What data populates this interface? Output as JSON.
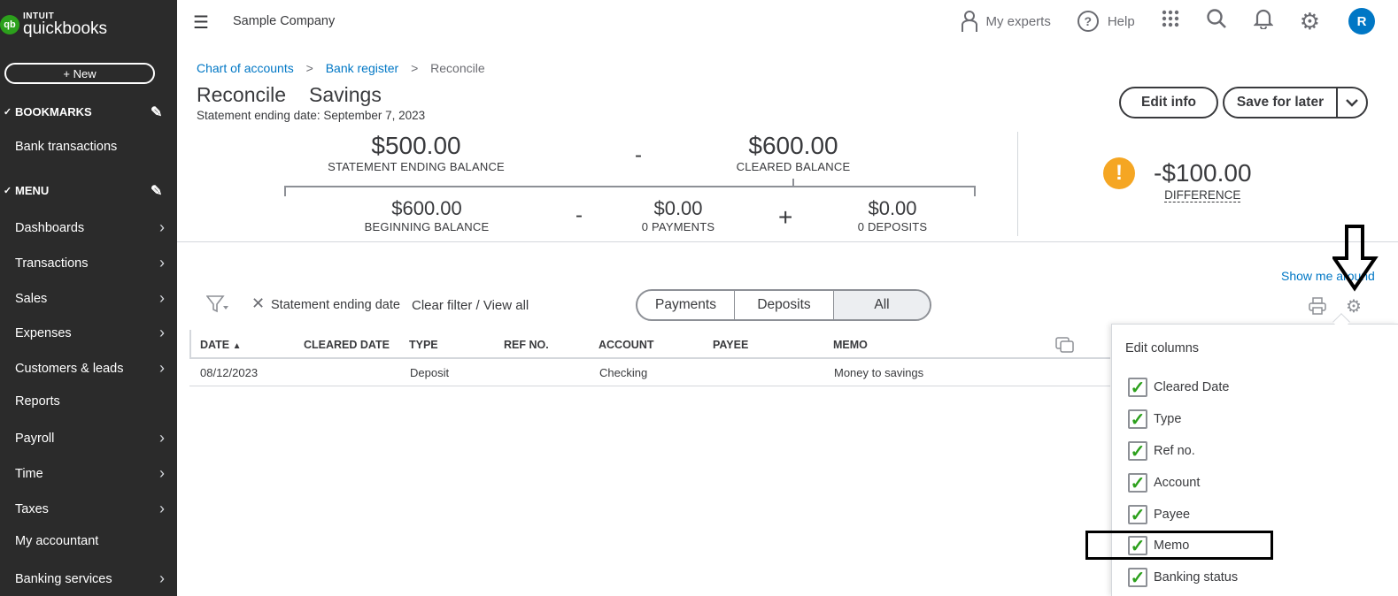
{
  "brand": {
    "intuit": "INTUIT",
    "product": "quickbooks",
    "mark": "qb"
  },
  "sidebar": {
    "new_label": "+ New",
    "bookmarks_label": "BOOKMARKS",
    "bookmark_items": [
      "Bank transactions"
    ],
    "menu_label": "MENU",
    "menu_items": [
      {
        "label": "Dashboards",
        "arrow": true
      },
      {
        "label": "Transactions",
        "arrow": true
      },
      {
        "label": "Sales",
        "arrow": true
      },
      {
        "label": "Expenses",
        "arrow": true
      },
      {
        "label": "Customers & leads",
        "arrow": true
      },
      {
        "label": "Reports",
        "arrow": false
      },
      {
        "label": "Payroll",
        "arrow": true
      },
      {
        "label": "Time",
        "arrow": true
      },
      {
        "label": "Taxes",
        "arrow": true
      },
      {
        "label": "My accountant",
        "arrow": false
      },
      {
        "label": "Banking services",
        "arrow": true
      }
    ]
  },
  "topbar": {
    "company": "Sample Company",
    "my_experts": "My experts",
    "help": "Help",
    "avatar_initial": "R"
  },
  "breadcrumb": {
    "items": [
      "Chart of accounts",
      "Bank register"
    ],
    "current": "Reconcile"
  },
  "page": {
    "title": "Reconcile",
    "account": "Savings",
    "subtitle": "Statement ending date: September 7, 2023",
    "edit_info": "Edit info",
    "save_for_later": "Save for later"
  },
  "summary": {
    "statement_ending_balance": {
      "value": "$500.00",
      "label": "STATEMENT ENDING BALANCE"
    },
    "cleared_balance": {
      "value": "$600.00",
      "label": "CLEARED BALANCE"
    },
    "beginning_balance": {
      "value": "$600.00",
      "label": "BEGINNING BALANCE"
    },
    "payments": {
      "value": "$0.00",
      "label": "0 PAYMENTS"
    },
    "deposits": {
      "value": "$0.00",
      "label": "0 DEPOSITS"
    },
    "difference": {
      "value": "-$100.00",
      "label": "DIFFERENCE"
    },
    "minus": "-",
    "plus": "+"
  },
  "toolbar": {
    "show_me_around": "Show me around",
    "filter_chip": "Statement ending date",
    "clear_filter": "Clear filter / View all",
    "segments": [
      "Payments",
      "Deposits",
      "All"
    ],
    "active_segment": "All"
  },
  "table": {
    "columns": [
      "DATE",
      "CLEARED DATE",
      "TYPE",
      "REF NO.",
      "ACCOUNT",
      "PAYEE",
      "MEMO"
    ],
    "rows": [
      {
        "date": "08/12/2023",
        "cleared_date": "",
        "type": "Deposit",
        "ref_no": "",
        "account": "Checking",
        "payee": "",
        "memo": "Money to savings"
      }
    ]
  },
  "edit_columns": {
    "title": "Edit columns",
    "options": [
      {
        "label": "Cleared Date",
        "checked": true
      },
      {
        "label": "Type",
        "checked": true
      },
      {
        "label": "Ref no.",
        "checked": true
      },
      {
        "label": "Account",
        "checked": true
      },
      {
        "label": "Payee",
        "checked": true
      },
      {
        "label": "Memo",
        "checked": true
      },
      {
        "label": "Banking status",
        "checked": true
      }
    ]
  },
  "colors": {
    "sidebar_bg": "#2b2b2b",
    "link": "#0077c5",
    "check_green": "#2ca01c",
    "warning": "#f5a623"
  }
}
